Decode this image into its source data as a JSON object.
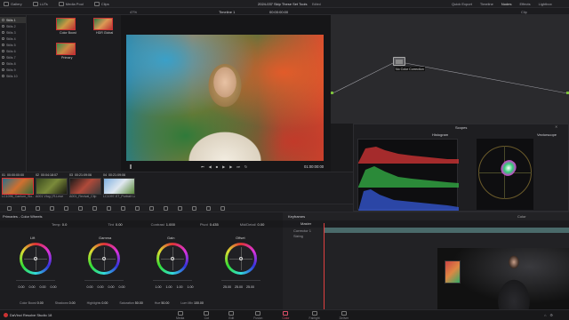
{
  "topbar": {
    "items": [
      "Gallery",
      "LUTs",
      "Media Pool",
      "Clips"
    ],
    "title": "2024-037 Skip These Set Tools",
    "edited": "Edited",
    "right": [
      "Quick Export",
      "Timeline",
      "Nodes",
      "Effects",
      "Lightbox"
    ]
  },
  "viewer_bar": {
    "zoom": "47%",
    "timeline": "Timeline 1",
    "timecode": "00:00:00:00",
    "clip_label": "Clip"
  },
  "left_panel": {
    "items": [
      "Stills 1",
      "Stills 2",
      "Stills 3",
      "Stills 4",
      "Stills 5",
      "Stills 6",
      "Stills 7",
      "Stills 8",
      "Stills 9",
      "Stills 10"
    ],
    "selected": 0
  },
  "stills": [
    {
      "label": "1.1.1",
      "caption": "Color Boost"
    },
    {
      "label": "1.1.2",
      "caption": "HDR Global"
    },
    {
      "label": "1.1.3",
      "caption": "Primary"
    }
  ],
  "viewer": {
    "timecode": "01:00:00:00"
  },
  "node": {
    "label": "No Color Correction",
    "num": "01"
  },
  "scopes": {
    "title": "Scopes",
    "histogram": "Histogram",
    "vectorscope": "Vectorscope"
  },
  "clips": [
    {
      "tc": "00:00:00:00",
      "name": "LC1096_Caelum_Slo...",
      "num": "01"
    },
    {
      "tc": "00:04:18:07",
      "name": "A001 Vlog | R-Lnse",
      "num": "02"
    },
    {
      "tc": "00:21:09:06",
      "name": "A001_Revival_Clip",
      "num": "03"
    },
    {
      "tc": "00:21:09:06",
      "name": "LC1097-ST_Portrait Lum",
      "num": "04"
    }
  ],
  "color_panel": {
    "title": "Primaries - Color Wheels",
    "temp_label": "Temp",
    "temp": "0.0",
    "tint_label": "Tint",
    "tint": "0.00",
    "contrast_label": "Contrast",
    "contrast": "1.000",
    "pivot_label": "Pivot",
    "pivot": "0.435",
    "md_label": "Mid/Detail",
    "md": "0.00",
    "wheels": [
      {
        "name": "Lift",
        "vals": [
          "0.00",
          "0.00",
          "0.00",
          "0.00"
        ]
      },
      {
        "name": "Gamma",
        "vals": [
          "0.00",
          "0.00",
          "0.00",
          "0.00"
        ]
      },
      {
        "name": "Gain",
        "vals": [
          "1.00",
          "1.00",
          "1.00",
          "1.00"
        ]
      },
      {
        "name": "Offset",
        "vals": [
          "25.00",
          "25.00",
          "25.00"
        ]
      }
    ],
    "bottom": [
      [
        "Color Boost",
        "0.00"
      ],
      [
        "Shadows",
        "0.00"
      ],
      [
        "Highlights",
        "0.00"
      ],
      [
        "Saturation",
        "50.00"
      ],
      [
        "Hue",
        "50.00"
      ],
      [
        "Lum Mix",
        "100.00"
      ]
    ]
  },
  "keyframes": {
    "title": "Keyframes",
    "master": "Master",
    "corrector": "Corrector 1",
    "sizing": "Sizing",
    "tc": "00:00:00:00",
    "mode": "Color"
  },
  "status": {
    "app": "DaVinci Resolve Studio 18"
  },
  "nav": [
    {
      "label": "Media"
    },
    {
      "label": "Cut"
    },
    {
      "label": "Edit"
    },
    {
      "label": "Fusion"
    },
    {
      "label": "Color",
      "active": true
    },
    {
      "label": "Fairlight"
    },
    {
      "label": "Deliver"
    }
  ]
}
